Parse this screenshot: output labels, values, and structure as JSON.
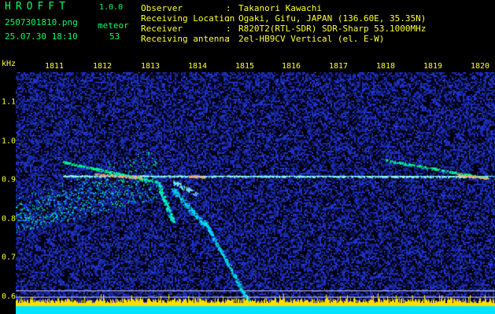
{
  "header": {
    "app_title": "HROFFT",
    "app_version": "1.0.0",
    "file_name": "2507301810.png",
    "mode": "meteor",
    "date_time": "25.07.30 18:10",
    "count": "53"
  },
  "station": [
    {
      "label": "Observer",
      "value": "Takanori Kawachi"
    },
    {
      "label": "Receiving Location",
      "value": "Ogaki, Gifu, JAPAN (136.60E, 35.35N)"
    },
    {
      "label": "Receiver",
      "value": "R820T2(RTL-SDR) SDR-Sharp 53.1000MHz"
    },
    {
      "label": "Receiving antenna",
      "value": "2el-HB9CV Vertical (el. E-W)"
    }
  ],
  "separator": ":",
  "freq_axis": {
    "unit": "kHz",
    "ticks": [
      "1.1",
      "1.0",
      "0.9",
      "0.8",
      "0.7",
      "0.6"
    ],
    "tick_values": [
      1.1,
      1.0,
      0.9,
      0.8,
      0.7,
      0.6
    ]
  },
  "time_axis": {
    "ticks": [
      "1811",
      "1812",
      "1813",
      "1814",
      "1815",
      "1816",
      "1817",
      "1818",
      "1819",
      "1820"
    ],
    "tick_minutes": [
      11,
      12,
      13,
      14,
      15,
      16,
      17,
      18,
      19,
      20
    ]
  },
  "colors": {
    "background": "#000000",
    "noise": "#1a2a9a",
    "trace": "#00ff99",
    "header_text": "#ffff33",
    "title_text": "#00ff66",
    "baseline_yellow": "#ffdd00",
    "baseline_cyan": "#00e5ff"
  }
}
